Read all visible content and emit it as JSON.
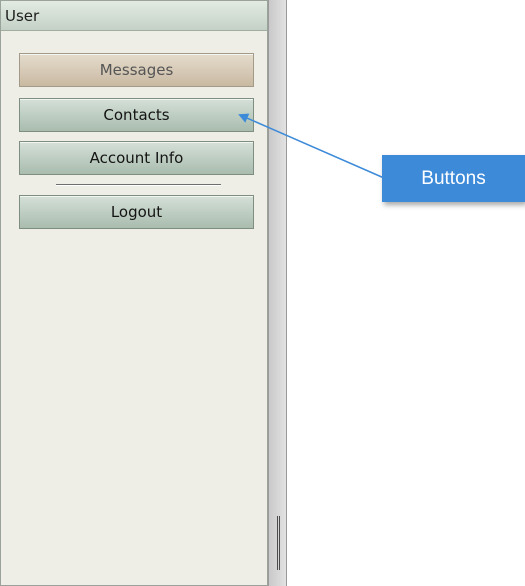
{
  "panel": {
    "title": "User"
  },
  "buttons": {
    "messages": "Messages",
    "contacts": "Contacts",
    "account_info": "Account Info",
    "logout": "Logout"
  },
  "callout": {
    "label": "Buttons"
  },
  "colors": {
    "callout": "#3d8ad9",
    "button_active": "#d9cbb7",
    "button": "#c2d1c6"
  }
}
